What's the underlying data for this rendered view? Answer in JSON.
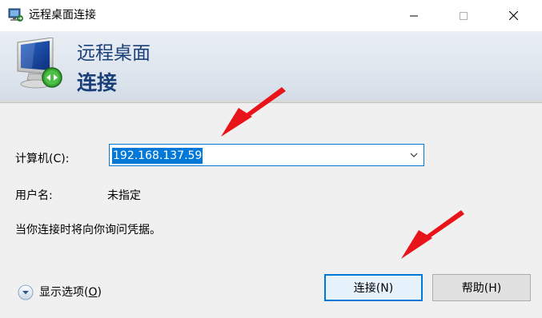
{
  "window": {
    "title": "远程桌面连接",
    "icons": [
      "remote-desktop-icon",
      "minimize-icon",
      "maximize-icon",
      "close-icon"
    ]
  },
  "header": {
    "title": "远程桌面",
    "subtitle": "连接",
    "icon": "remote-desktop-monitor-icon"
  },
  "form": {
    "computer_label": "计算机(C):",
    "computer_value": "192.168.137.59",
    "user_label": "用户名:",
    "user_value": "未指定",
    "notice": "当你连接时将向你询问凭据。"
  },
  "footer": {
    "show_options_label": "显示选项(",
    "show_options_key": "O",
    "show_options_end": ")",
    "connect_label": "连接(N)",
    "help_label": "帮助(H)"
  },
  "colors": {
    "accent": "#0078d7",
    "header_text": "#1b3f78",
    "annotation_arrow": "#e8141a"
  }
}
